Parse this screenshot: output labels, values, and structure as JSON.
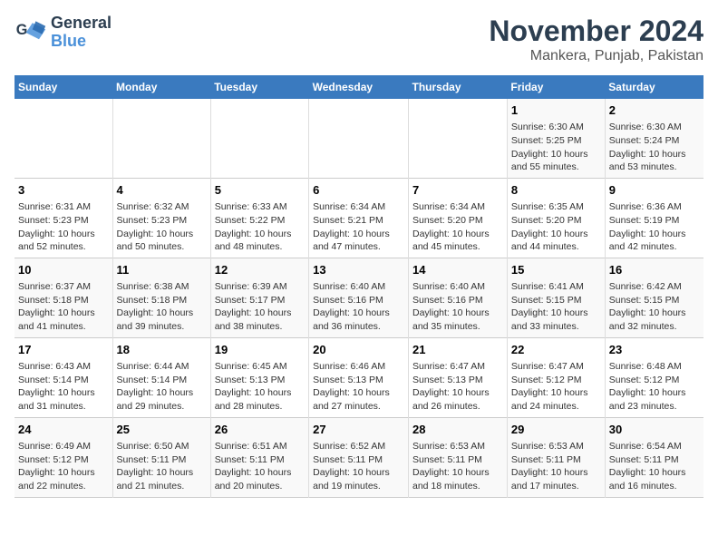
{
  "logo": {
    "line1": "General",
    "line2": "Blue"
  },
  "title": "November 2024",
  "subtitle": "Mankera, Punjab, Pakistan",
  "headers": [
    "Sunday",
    "Monday",
    "Tuesday",
    "Wednesday",
    "Thursday",
    "Friday",
    "Saturday"
  ],
  "weeks": [
    [
      {
        "day": "",
        "info": ""
      },
      {
        "day": "",
        "info": ""
      },
      {
        "day": "",
        "info": ""
      },
      {
        "day": "",
        "info": ""
      },
      {
        "day": "",
        "info": ""
      },
      {
        "day": "1",
        "info": "Sunrise: 6:30 AM\nSunset: 5:25 PM\nDaylight: 10 hours\nand 55 minutes."
      },
      {
        "day": "2",
        "info": "Sunrise: 6:30 AM\nSunset: 5:24 PM\nDaylight: 10 hours\nand 53 minutes."
      }
    ],
    [
      {
        "day": "3",
        "info": "Sunrise: 6:31 AM\nSunset: 5:23 PM\nDaylight: 10 hours\nand 52 minutes."
      },
      {
        "day": "4",
        "info": "Sunrise: 6:32 AM\nSunset: 5:23 PM\nDaylight: 10 hours\nand 50 minutes."
      },
      {
        "day": "5",
        "info": "Sunrise: 6:33 AM\nSunset: 5:22 PM\nDaylight: 10 hours\nand 48 minutes."
      },
      {
        "day": "6",
        "info": "Sunrise: 6:34 AM\nSunset: 5:21 PM\nDaylight: 10 hours\nand 47 minutes."
      },
      {
        "day": "7",
        "info": "Sunrise: 6:34 AM\nSunset: 5:20 PM\nDaylight: 10 hours\nand 45 minutes."
      },
      {
        "day": "8",
        "info": "Sunrise: 6:35 AM\nSunset: 5:20 PM\nDaylight: 10 hours\nand 44 minutes."
      },
      {
        "day": "9",
        "info": "Sunrise: 6:36 AM\nSunset: 5:19 PM\nDaylight: 10 hours\nand 42 minutes."
      }
    ],
    [
      {
        "day": "10",
        "info": "Sunrise: 6:37 AM\nSunset: 5:18 PM\nDaylight: 10 hours\nand 41 minutes."
      },
      {
        "day": "11",
        "info": "Sunrise: 6:38 AM\nSunset: 5:18 PM\nDaylight: 10 hours\nand 39 minutes."
      },
      {
        "day": "12",
        "info": "Sunrise: 6:39 AM\nSunset: 5:17 PM\nDaylight: 10 hours\nand 38 minutes."
      },
      {
        "day": "13",
        "info": "Sunrise: 6:40 AM\nSunset: 5:16 PM\nDaylight: 10 hours\nand 36 minutes."
      },
      {
        "day": "14",
        "info": "Sunrise: 6:40 AM\nSunset: 5:16 PM\nDaylight: 10 hours\nand 35 minutes."
      },
      {
        "day": "15",
        "info": "Sunrise: 6:41 AM\nSunset: 5:15 PM\nDaylight: 10 hours\nand 33 minutes."
      },
      {
        "day": "16",
        "info": "Sunrise: 6:42 AM\nSunset: 5:15 PM\nDaylight: 10 hours\nand 32 minutes."
      }
    ],
    [
      {
        "day": "17",
        "info": "Sunrise: 6:43 AM\nSunset: 5:14 PM\nDaylight: 10 hours\nand 31 minutes."
      },
      {
        "day": "18",
        "info": "Sunrise: 6:44 AM\nSunset: 5:14 PM\nDaylight: 10 hours\nand 29 minutes."
      },
      {
        "day": "19",
        "info": "Sunrise: 6:45 AM\nSunset: 5:13 PM\nDaylight: 10 hours\nand 28 minutes."
      },
      {
        "day": "20",
        "info": "Sunrise: 6:46 AM\nSunset: 5:13 PM\nDaylight: 10 hours\nand 27 minutes."
      },
      {
        "day": "21",
        "info": "Sunrise: 6:47 AM\nSunset: 5:13 PM\nDaylight: 10 hours\nand 26 minutes."
      },
      {
        "day": "22",
        "info": "Sunrise: 6:47 AM\nSunset: 5:12 PM\nDaylight: 10 hours\nand 24 minutes."
      },
      {
        "day": "23",
        "info": "Sunrise: 6:48 AM\nSunset: 5:12 PM\nDaylight: 10 hours\nand 23 minutes."
      }
    ],
    [
      {
        "day": "24",
        "info": "Sunrise: 6:49 AM\nSunset: 5:12 PM\nDaylight: 10 hours\nand 22 minutes."
      },
      {
        "day": "25",
        "info": "Sunrise: 6:50 AM\nSunset: 5:11 PM\nDaylight: 10 hours\nand 21 minutes."
      },
      {
        "day": "26",
        "info": "Sunrise: 6:51 AM\nSunset: 5:11 PM\nDaylight: 10 hours\nand 20 minutes."
      },
      {
        "day": "27",
        "info": "Sunrise: 6:52 AM\nSunset: 5:11 PM\nDaylight: 10 hours\nand 19 minutes."
      },
      {
        "day": "28",
        "info": "Sunrise: 6:53 AM\nSunset: 5:11 PM\nDaylight: 10 hours\nand 18 minutes."
      },
      {
        "day": "29",
        "info": "Sunrise: 6:53 AM\nSunset: 5:11 PM\nDaylight: 10 hours\nand 17 minutes."
      },
      {
        "day": "30",
        "info": "Sunrise: 6:54 AM\nSunset: 5:11 PM\nDaylight: 10 hours\nand 16 minutes."
      }
    ]
  ]
}
